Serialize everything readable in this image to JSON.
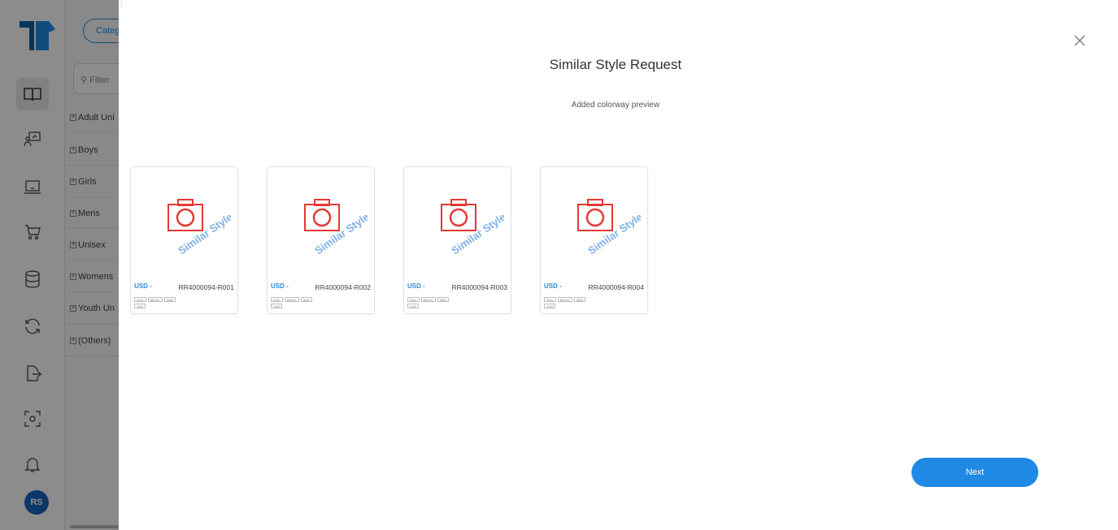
{
  "sidebar": {
    "logo": "tshirt-logo",
    "avatar_initials": "RS",
    "items": [
      {
        "icon": "book-icon",
        "active": true
      },
      {
        "icon": "presentation-icon"
      },
      {
        "icon": "laptop-icon"
      },
      {
        "icon": "cart-icon"
      },
      {
        "icon": "database-icon"
      },
      {
        "icon": "sync-icon"
      },
      {
        "icon": "export-icon"
      },
      {
        "icon": "scan-icon"
      },
      {
        "icon": "bell-icon"
      }
    ]
  },
  "category_panel": {
    "chip_label": "Categ",
    "filter_placeholder": "Filter",
    "categories": [
      "Adult Uni",
      "Boys",
      "Girls",
      "Mens",
      "Unisex",
      "Womens",
      "Youth Un",
      "(Others)"
    ]
  },
  "modal": {
    "title": "Similar Style Request",
    "subtitle": "Added colorway preview",
    "watermark": "Similar Style Request",
    "cards": [
      {
        "price": "USD -",
        "sku": "RR4000094-R001",
        "sizes": [
          "S/XL",
          "M/XXL",
          "3/4X",
          "1X/2"
        ]
      },
      {
        "price": "USD -",
        "sku": "RR4000094-R002",
        "sizes": [
          "S/XL",
          "M/XXL",
          "3/4X",
          "1X/2"
        ]
      },
      {
        "price": "USD -",
        "sku": "RR4000094-R003",
        "sizes": [
          "S/XL",
          "M/XXL",
          "3/4X",
          "1X/2"
        ]
      },
      {
        "price": "USD -",
        "sku": "RR4000094-R004",
        "sizes": [
          "S/XL",
          "M/XXL",
          "3/4X",
          "1X/2"
        ]
      }
    ],
    "next_label": "Next"
  },
  "colors": {
    "accent": "#1e8ae6",
    "placeholder_red": "#e53935",
    "watermark_blue": "#7fb2e5"
  }
}
